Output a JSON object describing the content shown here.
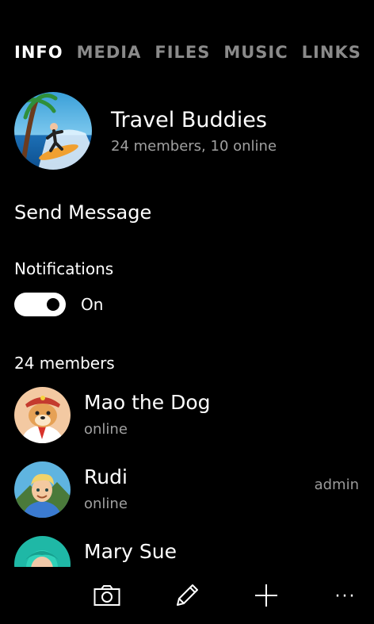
{
  "tabs": [
    {
      "label": "INFO",
      "active": true
    },
    {
      "label": "MEDIA",
      "active": false
    },
    {
      "label": "FILES",
      "active": false
    },
    {
      "label": "MUSIC",
      "active": false
    },
    {
      "label": "LINKS",
      "active": false
    }
  ],
  "group": {
    "title": "Travel Buddies",
    "subtitle": "24 members, 10 online"
  },
  "actions": {
    "send_message": "Send Message"
  },
  "notifications": {
    "label": "Notifications",
    "state": "On",
    "enabled": true
  },
  "members": {
    "count_label": "24 members",
    "items": [
      {
        "name": "Mao the Dog",
        "status": "online",
        "role": ""
      },
      {
        "name": "Rudi",
        "status": "online",
        "role": "admin"
      },
      {
        "name": "Mary Sue",
        "status": "",
        "role": ""
      }
    ]
  },
  "appbar": {
    "icons": [
      "camera-icon",
      "pencil-icon",
      "plus-icon",
      "more-icon"
    ],
    "more_glyph": "···"
  },
  "colors": {
    "background": "#000000",
    "text_primary": "#ffffff",
    "text_secondary": "#a0a0a0",
    "tab_inactive": "#8a8a8a"
  }
}
